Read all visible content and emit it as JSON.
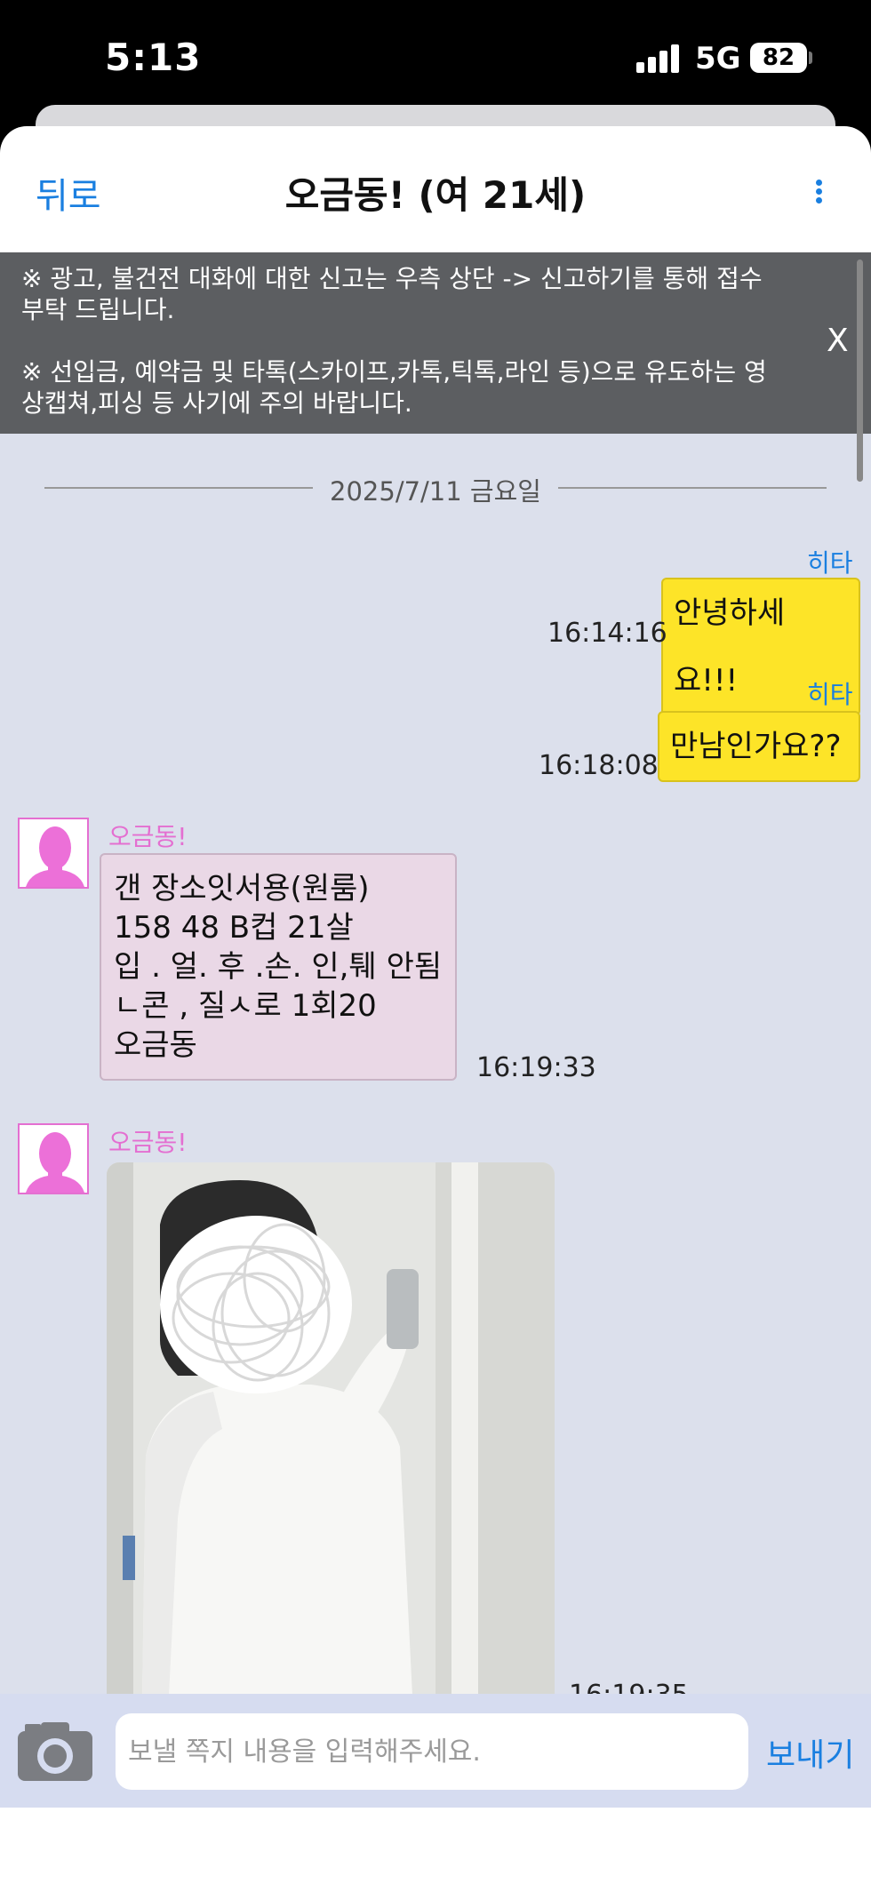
{
  "status_bar": {
    "time": "5:13",
    "network": "5G",
    "battery": "82"
  },
  "header": {
    "back_label": "뒤로",
    "title": "오금동! (여 21세)"
  },
  "notice": {
    "line1": "※ 광고, 불건전 대화에 대한 신고는 우측 상단 -> 신고하기를 통해 접수 부탁 드립니다.",
    "line2": "※ 선입금, 예약금 및 타톡(스카이프,카톡,틱톡,라인 등)으로 유도하는 영상캡쳐,피싱 등 사기에 주의 바랍니다.",
    "close_label": "X"
  },
  "date_separator": "2025/7/11 금요일",
  "messages": [
    {
      "sender": "히타",
      "text": "안녕하세요!!!",
      "time": "16:14:16",
      "mine": true
    },
    {
      "sender": "히타",
      "text": "만남인가요??",
      "time": "16:18:08",
      "mine": true
    },
    {
      "sender": "오금동!",
      "lines": [
        "갠 장소잇서용(원룸)",
        "158 48 B컵 21살",
        "입 . 얼. 후 .손. 인,퉤 안됨",
        "ㄴ콘 , 질ㅅ로 1회20",
        "오금동"
      ],
      "time": "16:19:33",
      "mine": false
    },
    {
      "sender": "오금동!",
      "type": "photo",
      "time": "16:19:35",
      "mine": false
    }
  ],
  "input": {
    "placeholder": "보낼 쪽지 내용을 입력해주세요.",
    "send_label": "보내기"
  },
  "icons": {
    "back": "text-link",
    "more": "vertical-dots-icon",
    "camera": "camera-icon",
    "avatar": "female-silhouette-icon"
  },
  "colors": {
    "accent": "#1a7fe0",
    "my_bubble": "#fde428",
    "other_bubble": "#ead8e6",
    "other_name": "#e46fd1",
    "chat_bg": "#dce0ec"
  }
}
